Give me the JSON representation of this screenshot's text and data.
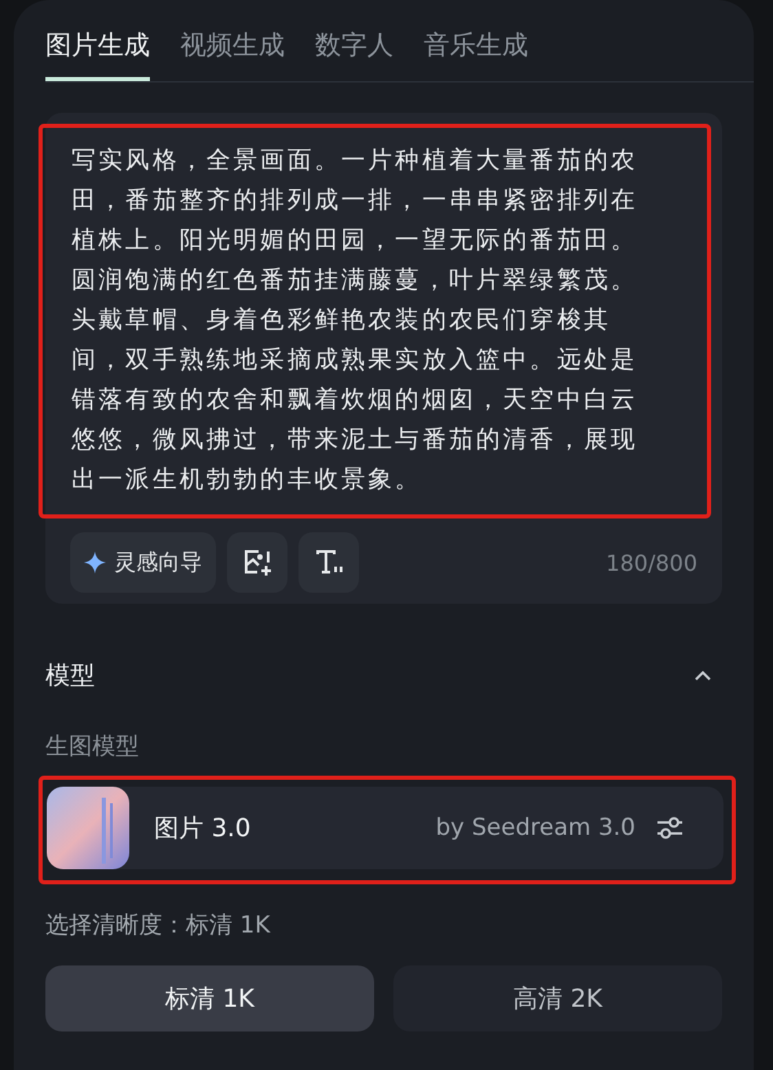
{
  "tabs": [
    {
      "label": "图片生成",
      "selected": true
    },
    {
      "label": "视频生成",
      "selected": false
    },
    {
      "label": "数字人",
      "selected": false
    },
    {
      "label": "音乐生成",
      "selected": false
    }
  ],
  "prompt": {
    "value": "写实风格，全景画面。一片种植着大量番茄的农田，番茄整齐的排列成一排，一串串紧密排列在植株上。阳光明媚的田园，一望无际的番茄田。圆润饱满的红色番茄挂满藤蔓，叶片翠绿繁茂。头戴草帽、身着色彩鲜艳农装的农民们穿梭其间，双手熟练地采摘成熟果实放入篮中。远处是错落有致的农舍和飘着炊烟的烟囱，天空中白云悠悠，微风拂过，带来泥土与番茄的清香，展现出一派生机勃勃的丰收景象。",
    "highlighted": true,
    "inspiration_button": "灵感向导",
    "counter": "180/800"
  },
  "model_section": {
    "title": "模型",
    "expanded": true,
    "label": "生图模型",
    "model": {
      "name": "图片 3.0",
      "provider": "by Seedream 3.0",
      "highlighted": true
    }
  },
  "resolution": {
    "label": "选择清晰度：标清 1K",
    "options": [
      {
        "label": "标清 1K",
        "selected": true
      },
      {
        "label": "高清 2K",
        "selected": false
      }
    ]
  }
}
